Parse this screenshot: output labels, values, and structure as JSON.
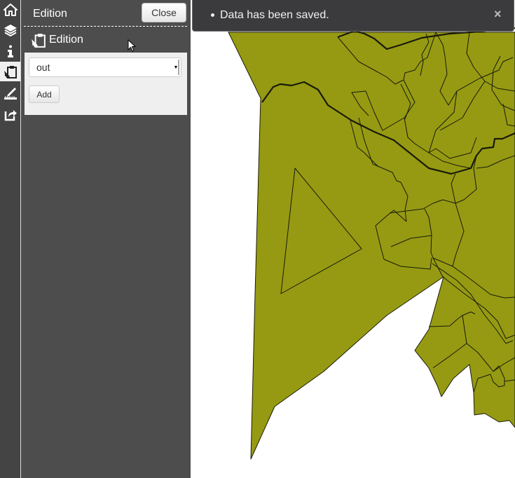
{
  "toolbar": {
    "items": [
      {
        "name": "home",
        "icon": "home-icon",
        "active": false
      },
      {
        "name": "layers",
        "icon": "layers-icon",
        "active": false
      },
      {
        "name": "information",
        "icon": "info-icon",
        "active": false
      },
      {
        "name": "edition",
        "icon": "edition-clipboard-icon",
        "active": true
      },
      {
        "name": "measure",
        "icon": "measure-ruler-icon",
        "active": false
      },
      {
        "name": "share",
        "icon": "share-icon",
        "active": false
      }
    ]
  },
  "dock": {
    "title": "Edition",
    "close_label": "Close",
    "subheader": "Edition",
    "layer_select": {
      "value": "out"
    },
    "add_label": "Add"
  },
  "notification": {
    "message": "Data has been saved.",
    "close_glyph": "×"
  },
  "map": {
    "fill_color": "#959a12",
    "stroke_color": "#1a1a0a"
  }
}
